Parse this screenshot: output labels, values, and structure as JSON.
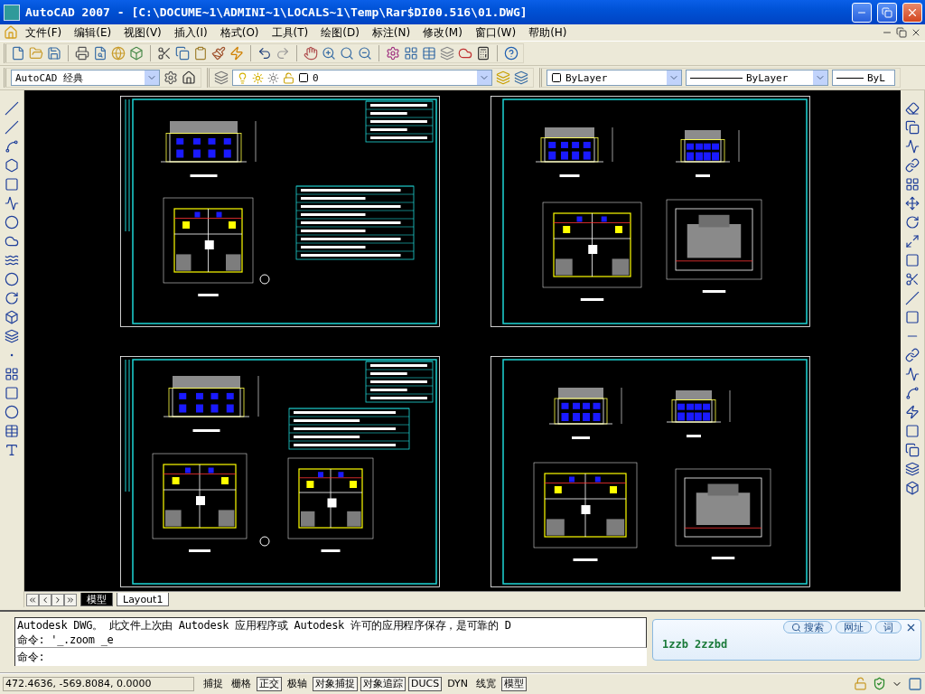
{
  "window": {
    "title": "AutoCAD 2007 - [C:\\DOCUME~1\\ADMINI~1\\LOCALS~1\\Temp\\Rar$DI00.516\\01.DWG]"
  },
  "menu": [
    {
      "label": "文件(F)"
    },
    {
      "label": "编辑(E)"
    },
    {
      "label": "视图(V)"
    },
    {
      "label": "插入(I)"
    },
    {
      "label": "格式(O)"
    },
    {
      "label": "工具(T)"
    },
    {
      "label": "绘图(D)"
    },
    {
      "label": "标注(N)"
    },
    {
      "label": "修改(M)"
    },
    {
      "label": "窗口(W)"
    },
    {
      "label": "帮助(H)"
    }
  ],
  "workspace": {
    "value": "AutoCAD 经典"
  },
  "layer": {
    "value": "0"
  },
  "properties": {
    "color_setting": "ByLayer",
    "linetype": "ByLayer",
    "lineweight": "ByL"
  },
  "layout_tabs": [
    {
      "label": "模型",
      "selected": true
    },
    {
      "label": "Layout1",
      "selected": false
    }
  ],
  "command_lines": [
    "Autodesk DWG。  此文件上次由 Autodesk 应用程序或 Autodesk 许可的应用程序保存，是可靠的 D",
    "命令: '_.zoom _e"
  ],
  "command_prompt": "命令:",
  "popup": {
    "buttons": [
      "搜索",
      "网址",
      "词"
    ],
    "text": "1zzb 2zzbd"
  },
  "status_bar": {
    "coordinates": "472.4636, -569.8084, 0.0000",
    "toggles": [
      {
        "label": "捕捉",
        "on": false
      },
      {
        "label": "栅格",
        "on": false
      },
      {
        "label": "正交",
        "on": true
      },
      {
        "label": "极轴",
        "on": false
      },
      {
        "label": "对象捕捉",
        "on": true
      },
      {
        "label": "对象追踪",
        "on": true
      },
      {
        "label": "DUCS",
        "on": true
      },
      {
        "label": "DYN",
        "on": false
      },
      {
        "label": "线宽",
        "on": false
      },
      {
        "label": "模型",
        "on": true
      }
    ]
  }
}
